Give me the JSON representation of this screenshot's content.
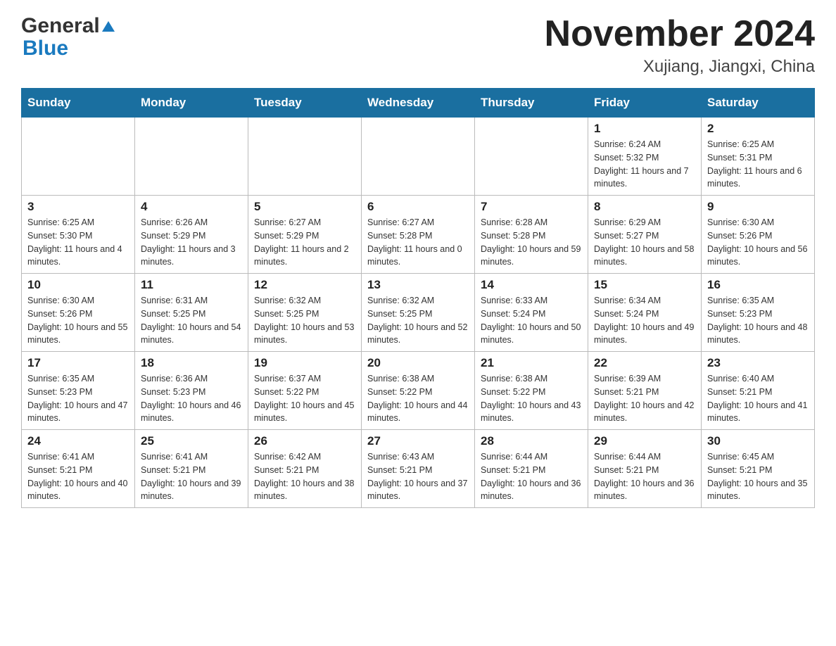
{
  "header": {
    "logo_general": "General",
    "logo_blue": "Blue",
    "month_title": "November 2024",
    "location": "Xujiang, Jiangxi, China"
  },
  "weekdays": [
    "Sunday",
    "Monday",
    "Tuesday",
    "Wednesday",
    "Thursday",
    "Friday",
    "Saturday"
  ],
  "rows": [
    [
      {
        "day": "",
        "sunrise": "",
        "sunset": "",
        "daylight": ""
      },
      {
        "day": "",
        "sunrise": "",
        "sunset": "",
        "daylight": ""
      },
      {
        "day": "",
        "sunrise": "",
        "sunset": "",
        "daylight": ""
      },
      {
        "day": "",
        "sunrise": "",
        "sunset": "",
        "daylight": ""
      },
      {
        "day": "",
        "sunrise": "",
        "sunset": "",
        "daylight": ""
      },
      {
        "day": "1",
        "sunrise": "Sunrise: 6:24 AM",
        "sunset": "Sunset: 5:32 PM",
        "daylight": "Daylight: 11 hours and 7 minutes."
      },
      {
        "day": "2",
        "sunrise": "Sunrise: 6:25 AM",
        "sunset": "Sunset: 5:31 PM",
        "daylight": "Daylight: 11 hours and 6 minutes."
      }
    ],
    [
      {
        "day": "3",
        "sunrise": "Sunrise: 6:25 AM",
        "sunset": "Sunset: 5:30 PM",
        "daylight": "Daylight: 11 hours and 4 minutes."
      },
      {
        "day": "4",
        "sunrise": "Sunrise: 6:26 AM",
        "sunset": "Sunset: 5:29 PM",
        "daylight": "Daylight: 11 hours and 3 minutes."
      },
      {
        "day": "5",
        "sunrise": "Sunrise: 6:27 AM",
        "sunset": "Sunset: 5:29 PM",
        "daylight": "Daylight: 11 hours and 2 minutes."
      },
      {
        "day": "6",
        "sunrise": "Sunrise: 6:27 AM",
        "sunset": "Sunset: 5:28 PM",
        "daylight": "Daylight: 11 hours and 0 minutes."
      },
      {
        "day": "7",
        "sunrise": "Sunrise: 6:28 AM",
        "sunset": "Sunset: 5:28 PM",
        "daylight": "Daylight: 10 hours and 59 minutes."
      },
      {
        "day": "8",
        "sunrise": "Sunrise: 6:29 AM",
        "sunset": "Sunset: 5:27 PM",
        "daylight": "Daylight: 10 hours and 58 minutes."
      },
      {
        "day": "9",
        "sunrise": "Sunrise: 6:30 AM",
        "sunset": "Sunset: 5:26 PM",
        "daylight": "Daylight: 10 hours and 56 minutes."
      }
    ],
    [
      {
        "day": "10",
        "sunrise": "Sunrise: 6:30 AM",
        "sunset": "Sunset: 5:26 PM",
        "daylight": "Daylight: 10 hours and 55 minutes."
      },
      {
        "day": "11",
        "sunrise": "Sunrise: 6:31 AM",
        "sunset": "Sunset: 5:25 PM",
        "daylight": "Daylight: 10 hours and 54 minutes."
      },
      {
        "day": "12",
        "sunrise": "Sunrise: 6:32 AM",
        "sunset": "Sunset: 5:25 PM",
        "daylight": "Daylight: 10 hours and 53 minutes."
      },
      {
        "day": "13",
        "sunrise": "Sunrise: 6:32 AM",
        "sunset": "Sunset: 5:25 PM",
        "daylight": "Daylight: 10 hours and 52 minutes."
      },
      {
        "day": "14",
        "sunrise": "Sunrise: 6:33 AM",
        "sunset": "Sunset: 5:24 PM",
        "daylight": "Daylight: 10 hours and 50 minutes."
      },
      {
        "day": "15",
        "sunrise": "Sunrise: 6:34 AM",
        "sunset": "Sunset: 5:24 PM",
        "daylight": "Daylight: 10 hours and 49 minutes."
      },
      {
        "day": "16",
        "sunrise": "Sunrise: 6:35 AM",
        "sunset": "Sunset: 5:23 PM",
        "daylight": "Daylight: 10 hours and 48 minutes."
      }
    ],
    [
      {
        "day": "17",
        "sunrise": "Sunrise: 6:35 AM",
        "sunset": "Sunset: 5:23 PM",
        "daylight": "Daylight: 10 hours and 47 minutes."
      },
      {
        "day": "18",
        "sunrise": "Sunrise: 6:36 AM",
        "sunset": "Sunset: 5:23 PM",
        "daylight": "Daylight: 10 hours and 46 minutes."
      },
      {
        "day": "19",
        "sunrise": "Sunrise: 6:37 AM",
        "sunset": "Sunset: 5:22 PM",
        "daylight": "Daylight: 10 hours and 45 minutes."
      },
      {
        "day": "20",
        "sunrise": "Sunrise: 6:38 AM",
        "sunset": "Sunset: 5:22 PM",
        "daylight": "Daylight: 10 hours and 44 minutes."
      },
      {
        "day": "21",
        "sunrise": "Sunrise: 6:38 AM",
        "sunset": "Sunset: 5:22 PM",
        "daylight": "Daylight: 10 hours and 43 minutes."
      },
      {
        "day": "22",
        "sunrise": "Sunrise: 6:39 AM",
        "sunset": "Sunset: 5:21 PM",
        "daylight": "Daylight: 10 hours and 42 minutes."
      },
      {
        "day": "23",
        "sunrise": "Sunrise: 6:40 AM",
        "sunset": "Sunset: 5:21 PM",
        "daylight": "Daylight: 10 hours and 41 minutes."
      }
    ],
    [
      {
        "day": "24",
        "sunrise": "Sunrise: 6:41 AM",
        "sunset": "Sunset: 5:21 PM",
        "daylight": "Daylight: 10 hours and 40 minutes."
      },
      {
        "day": "25",
        "sunrise": "Sunrise: 6:41 AM",
        "sunset": "Sunset: 5:21 PM",
        "daylight": "Daylight: 10 hours and 39 minutes."
      },
      {
        "day": "26",
        "sunrise": "Sunrise: 6:42 AM",
        "sunset": "Sunset: 5:21 PM",
        "daylight": "Daylight: 10 hours and 38 minutes."
      },
      {
        "day": "27",
        "sunrise": "Sunrise: 6:43 AM",
        "sunset": "Sunset: 5:21 PM",
        "daylight": "Daylight: 10 hours and 37 minutes."
      },
      {
        "day": "28",
        "sunrise": "Sunrise: 6:44 AM",
        "sunset": "Sunset: 5:21 PM",
        "daylight": "Daylight: 10 hours and 36 minutes."
      },
      {
        "day": "29",
        "sunrise": "Sunrise: 6:44 AM",
        "sunset": "Sunset: 5:21 PM",
        "daylight": "Daylight: 10 hours and 36 minutes."
      },
      {
        "day": "30",
        "sunrise": "Sunrise: 6:45 AM",
        "sunset": "Sunset: 5:21 PM",
        "daylight": "Daylight: 10 hours and 35 minutes."
      }
    ]
  ]
}
